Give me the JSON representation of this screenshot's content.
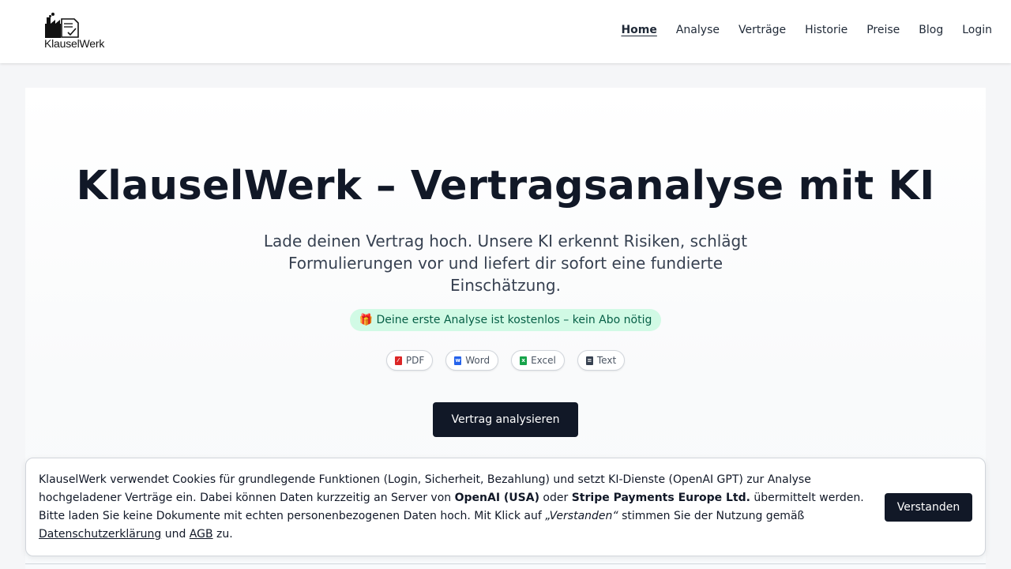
{
  "brand": {
    "name": "KlauselWerk"
  },
  "nav": {
    "items": [
      {
        "label": "Home",
        "active": true
      },
      {
        "label": "Analyse"
      },
      {
        "label": "Verträge"
      },
      {
        "label": "Historie"
      },
      {
        "label": "Preise"
      },
      {
        "label": "Blog"
      },
      {
        "label": "Login"
      }
    ]
  },
  "hero": {
    "title": "KlauselWerk – Vertragsanalyse mit KI",
    "subtitle": "Lade deinen Vertrag hoch. Unsere KI erkennt Risiken, schlägt Formulierungen vor und liefert dir sofort eine fundierte Einschätzung.",
    "promo_icon": "gift-icon",
    "promo": "🎁 Deine erste Analyse ist kostenlos – kein Abo nötig",
    "formats": [
      {
        "label": "PDF",
        "icon": "pdf-file-icon",
        "color": "#dc2626"
      },
      {
        "label": "Word",
        "icon": "word-file-icon",
        "color": "#2563eb"
      },
      {
        "label": "Excel",
        "icon": "excel-file-icon",
        "color": "#16a34a"
      },
      {
        "label": "Text",
        "icon": "text-file-icon",
        "color": "#374151"
      }
    ],
    "cta": "Vertrag analysieren"
  },
  "cookie": {
    "text_1": "KlauselWerk verwendet Cookies für grundlegende Funktionen (Login, Sicherheit, Bezahlung) und setzt KI-Dienste (OpenAI GPT) zur Analyse hochgeladener Verträge ein. Dabei können Daten kurzzeitig an Server von ",
    "strong_1": "OpenAI (USA)",
    "text_2": " oder ",
    "strong_2": "Stripe Payments Europe Ltd.",
    "text_3": " übermittelt werden. Bitte laden Sie keine Dokumente mit echten personenbezogenen Daten hoch. Mit Klick auf ",
    "quote": "„Verstanden“",
    "text_4": " stimmen Sie der Nutzung gemäß ",
    "link_privacy": "Datenschutzerklärung",
    "text_5": " und ",
    "link_terms": "AGB",
    "text_6": " zu.",
    "button": "Verstanden"
  },
  "colors": {
    "primary": "#111827",
    "promo_bg": "#d1fae5",
    "promo_text": "#065f46"
  }
}
